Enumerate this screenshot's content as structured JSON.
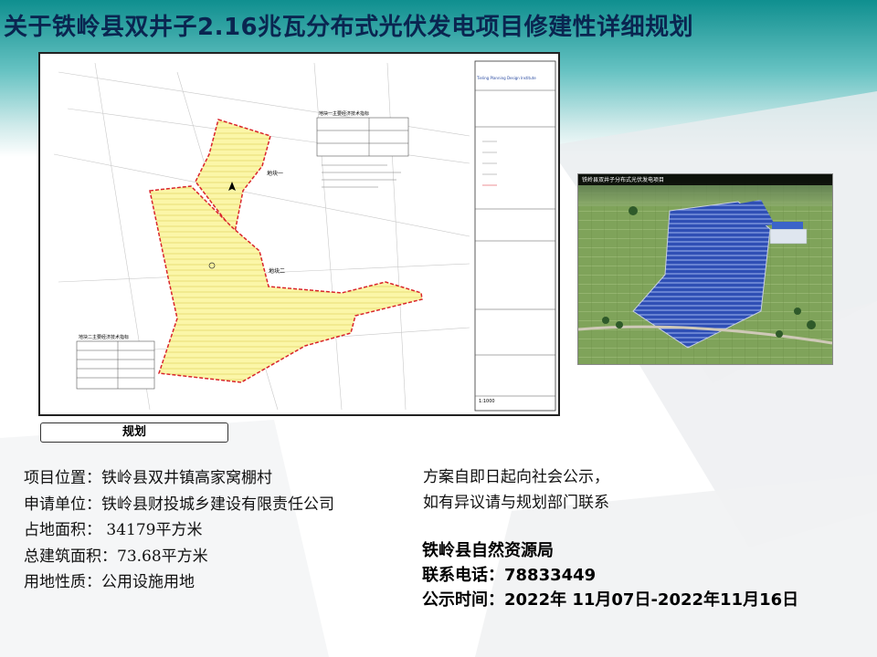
{
  "slide": {
    "title": "关于铁岭县双井子2.16兆瓦分布式光伏发电项目修建性详细规划",
    "plan_caption": "规划"
  },
  "project_info": [
    {
      "label": "项目位置：",
      "value": "铁岭县双井镇高家窝棚村"
    },
    {
      "label": "申请单位：",
      "value": "铁岭县财投城乡建设有限责任公司"
    },
    {
      "label": "占地面积：",
      "value": " 34179平方米"
    },
    {
      "label": "总建筑面积：",
      "value": "73.68平方米"
    },
    {
      "label": "用地性质：",
      "value": "公用设施用地"
    }
  ],
  "notice": [
    "方案自即日起向社会公示，",
    "如有异议请与规划部门联系"
  ],
  "contact": {
    "org": "铁岭县自然资源局",
    "phone_label": "联系电话：",
    "phone": "78833449",
    "period_label": "公示时间：",
    "period": "2022年 11月07日-2022年11月16日"
  },
  "drawing": {
    "block1_label": "地块一",
    "block2_label": "地块二",
    "table1_title": "地块一主要经济技术指标",
    "table2_title": "地块二主要经济技术指标",
    "institute_en": "Tieling Planning Design Institute",
    "scale": "1:1000"
  },
  "aerial_title": "铁岭县双井子分布式光伏发电项目",
  "colors": {
    "title_text": "#0a2550",
    "band_top": "#0f8f8f",
    "site_fill": "#f7f08a",
    "boundary": "#d9242b",
    "panel_blue": "#3a5fc8"
  }
}
